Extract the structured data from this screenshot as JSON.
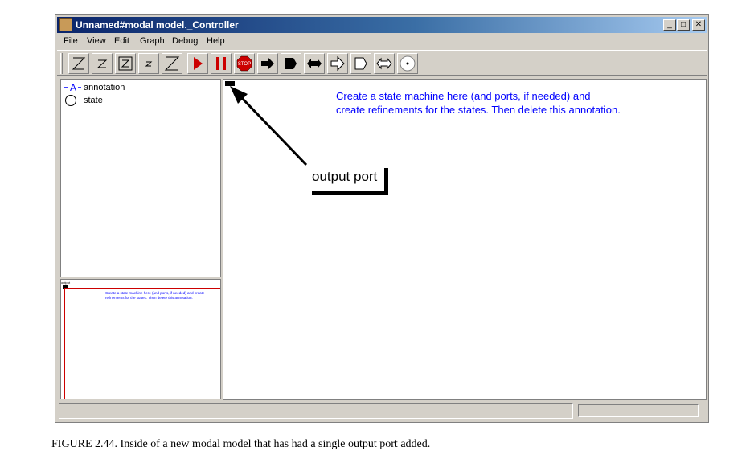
{
  "window": {
    "title": "Unnamed#modal model._Controller"
  },
  "window_controls": [
    "minimize",
    "maximize",
    "close"
  ],
  "menu": [
    "File",
    "View",
    "Edit",
    "Graph",
    "Debug",
    "Help"
  ],
  "toolbar": {
    "buttons": [
      "zoom-in-icon",
      "zoom-reset-icon",
      "zoom-fit-icon",
      "zoom-small-icon",
      "zoom-out-icon",
      "run-icon",
      "pause-icon",
      "stop-icon",
      "arrow-filled-right-icon",
      "flag-filled-icon",
      "arrow-double-filled-icon",
      "arrow-outline-right-icon",
      "flag-outline-icon",
      "arrow-double-outline-icon",
      "state-circle-icon"
    ],
    "colors": {
      "run": "#cc0000",
      "pause": "#cc0000",
      "stop": "#cc0000"
    }
  },
  "library": {
    "items": [
      {
        "label": "annotation",
        "icon": "annotation-icon"
      },
      {
        "label": "state",
        "icon": "state-circle-icon"
      }
    ]
  },
  "overview": {
    "port_label": "output",
    "annotation_text": "Create a state machine here (and ports, if needed) and create refinements for the states. Then delete this annotation."
  },
  "canvas": {
    "annotation_line1": "Create a state machine here (and ports, if needed) and",
    "annotation_line2": "create refinements for the states. Then delete this annotation.",
    "callout_label": "output port",
    "annotation_color": "#0000ff"
  },
  "caption": "FIGURE 2.44.  Inside of a new modal model that has had a single output port added."
}
